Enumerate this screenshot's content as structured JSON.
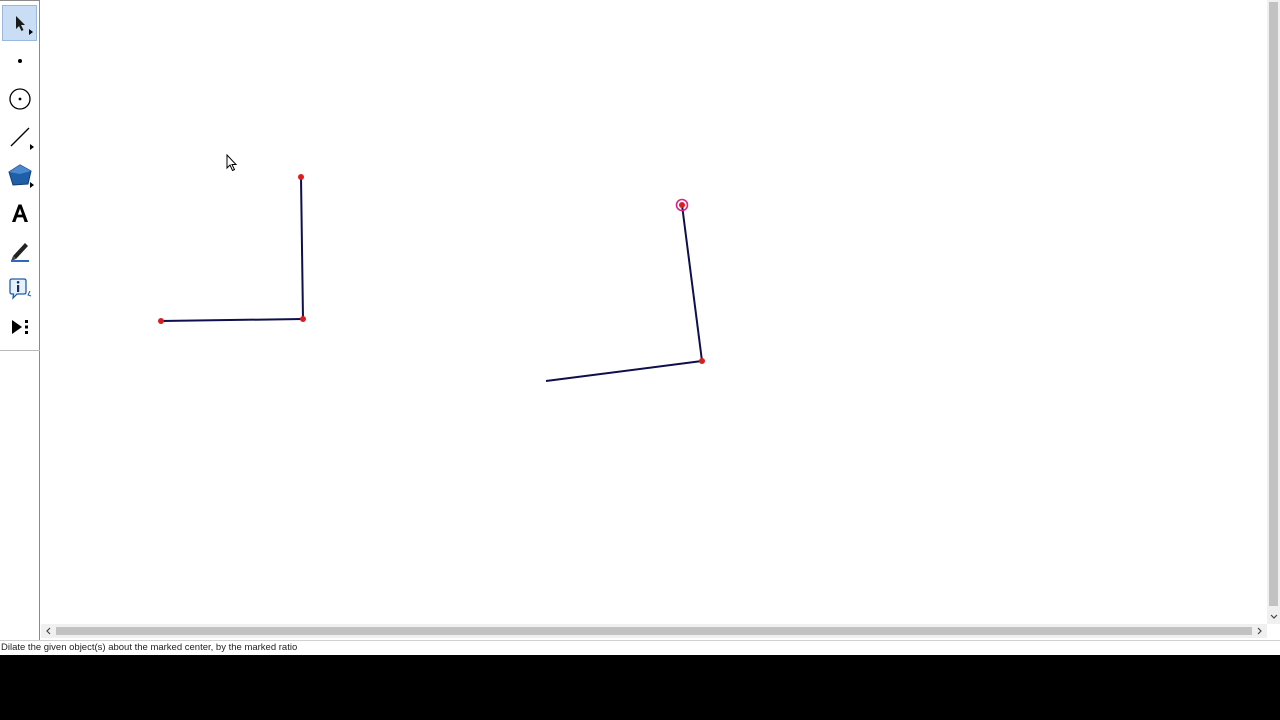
{
  "toolbox": {
    "tools": [
      {
        "name": "arrow-tool",
        "icon": "arrow-icon",
        "active": true,
        "has_menu": true
      },
      {
        "name": "point-tool",
        "icon": "point-icon",
        "active": false,
        "has_menu": false
      },
      {
        "name": "compass-tool",
        "icon": "compass-icon",
        "active": false,
        "has_menu": false
      },
      {
        "name": "straightedge-tool",
        "icon": "straightedge-icon",
        "active": false,
        "has_menu": true
      },
      {
        "name": "polygon-tool",
        "icon": "polygon-icon",
        "active": false,
        "has_menu": true
      },
      {
        "name": "text-tool",
        "icon": "text-icon",
        "label": "A",
        "active": false,
        "has_menu": false
      },
      {
        "name": "marker-tool",
        "icon": "marker-icon",
        "active": false,
        "has_menu": false
      },
      {
        "name": "information-tool",
        "icon": "information-icon",
        "label": "i",
        "active": false,
        "has_menu": false
      },
      {
        "name": "custom-tool",
        "icon": "play-custom-icon",
        "active": false,
        "has_menu": false
      }
    ]
  },
  "colors": {
    "segment": "#0f0f4b",
    "point": "#d81e1e",
    "selected_point": "#d6238b",
    "toolbar_active": "#c9def5",
    "scrollbar_track": "#f0f0f0",
    "scrollbar_thumb": "#c2c2c2"
  },
  "status_bar": {
    "text": "Dilate the given object(s) about the marked center, by the marked ratio"
  }
}
